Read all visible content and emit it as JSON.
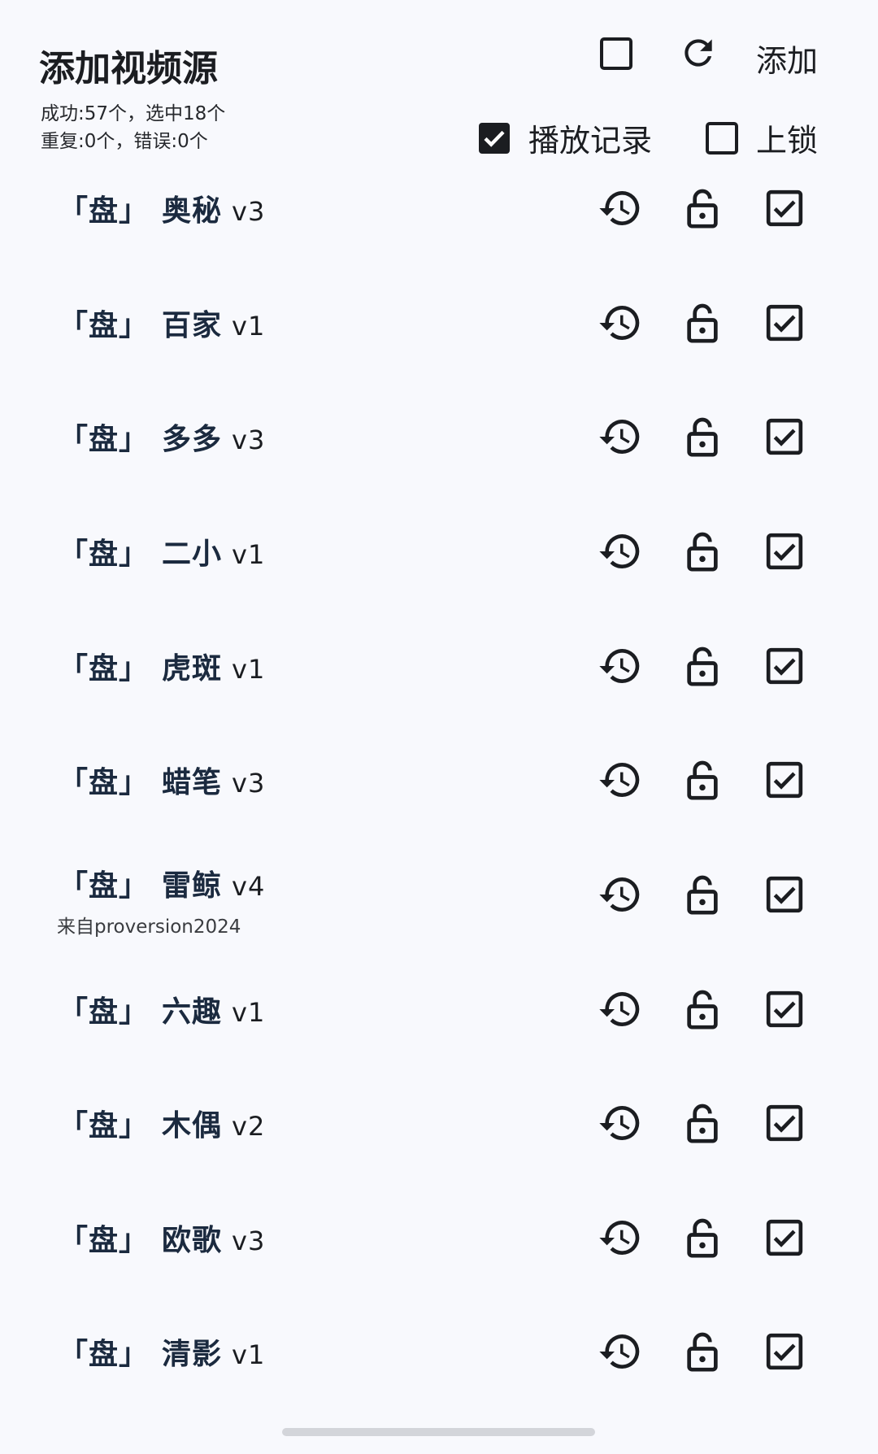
{
  "header": {
    "title": "添加视频源",
    "stat_line1": "成功:57个，选中18个",
    "stat_line2": "重复:0个，错误:0个",
    "add_label": "添加",
    "options": [
      {
        "label": "播放记录",
        "checked": true
      },
      {
        "label": "上锁",
        "checked": false
      }
    ]
  },
  "sources": [
    {
      "prefix": "「盘」",
      "name": "奥秘",
      "version": "v3",
      "note": ""
    },
    {
      "prefix": "「盘」",
      "name": "百家",
      "version": "v1",
      "note": ""
    },
    {
      "prefix": "「盘」",
      "name": "多多",
      "version": "v3",
      "note": ""
    },
    {
      "prefix": "「盘」",
      "name": "二小",
      "version": "v1",
      "note": ""
    },
    {
      "prefix": "「盘」",
      "name": "虎斑",
      "version": "v1",
      "note": ""
    },
    {
      "prefix": "「盘」",
      "name": "蜡笔",
      "version": "v3",
      "note": ""
    },
    {
      "prefix": "「盘」",
      "name": "雷鲸",
      "version": "v4",
      "note": "来自proversion2024"
    },
    {
      "prefix": "「盘」",
      "name": "六趣",
      "version": "v1",
      "note": ""
    },
    {
      "prefix": "「盘」",
      "name": "木偶",
      "version": "v2",
      "note": ""
    },
    {
      "prefix": "「盘」",
      "name": "欧歌",
      "version": "v3",
      "note": ""
    },
    {
      "prefix": "「盘」",
      "name": "清影",
      "version": "v1",
      "note": ""
    }
  ],
  "row_icons": [
    "history-icon",
    "unlock-icon",
    "checked-box-icon"
  ],
  "top_icons": [
    "empty-checkbox-icon",
    "refresh-icon"
  ],
  "colors": {
    "background": "#f8f9fd",
    "icon": "#1b1d21",
    "name_text": "#1b2a3f"
  }
}
